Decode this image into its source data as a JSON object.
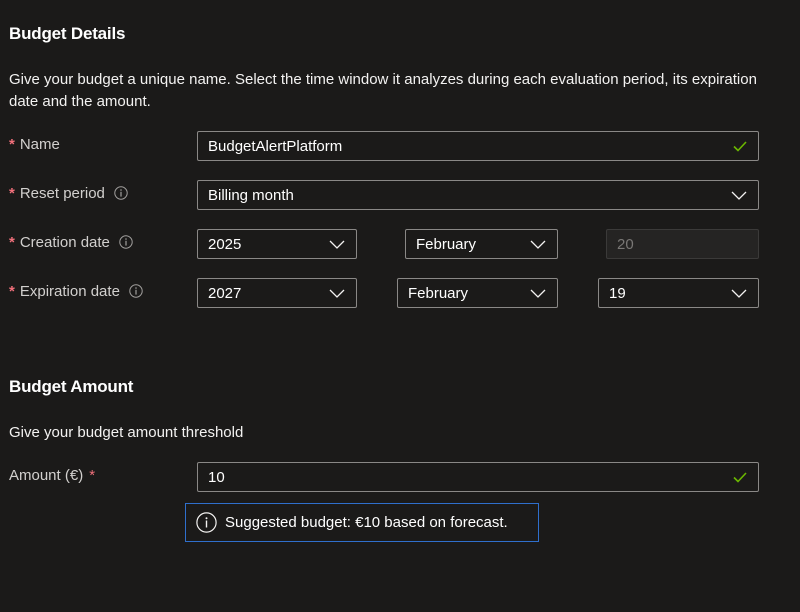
{
  "details": {
    "title": "Budget Details",
    "description": "Give your budget a unique name. Select the time window it analyzes during each evaluation period, its expiration date and the amount.",
    "name": {
      "label": "Name",
      "required_mark": "*",
      "value": "BudgetAlertPlatform",
      "valid": true
    },
    "reset_period": {
      "label": "Reset period",
      "required_mark": "*",
      "value": "Billing month"
    },
    "creation_date": {
      "label": "Creation date",
      "required_mark": "*",
      "year": "2025",
      "month": "February",
      "day": "20",
      "day_disabled": true
    },
    "expiration_date": {
      "label": "Expiration date",
      "required_mark": "*",
      "year": "2027",
      "month": "February",
      "day": "19"
    }
  },
  "amount": {
    "title": "Budget Amount",
    "description": "Give your budget amount threshold",
    "label": "Amount (€)",
    "required_mark": "*",
    "value": "10",
    "valid": true,
    "suggestion": "Suggested budget: €10 based on forecast."
  },
  "icons": {
    "info": "info-circle-icon",
    "dropdown": "chevron-down-icon",
    "valid": "checkmark-icon"
  },
  "colors": {
    "background": "#1b1a19",
    "required": "#f1707b",
    "valid_check": "#6bb700",
    "callout_border": "#2f6fcc",
    "field_border": "#8a8886"
  }
}
